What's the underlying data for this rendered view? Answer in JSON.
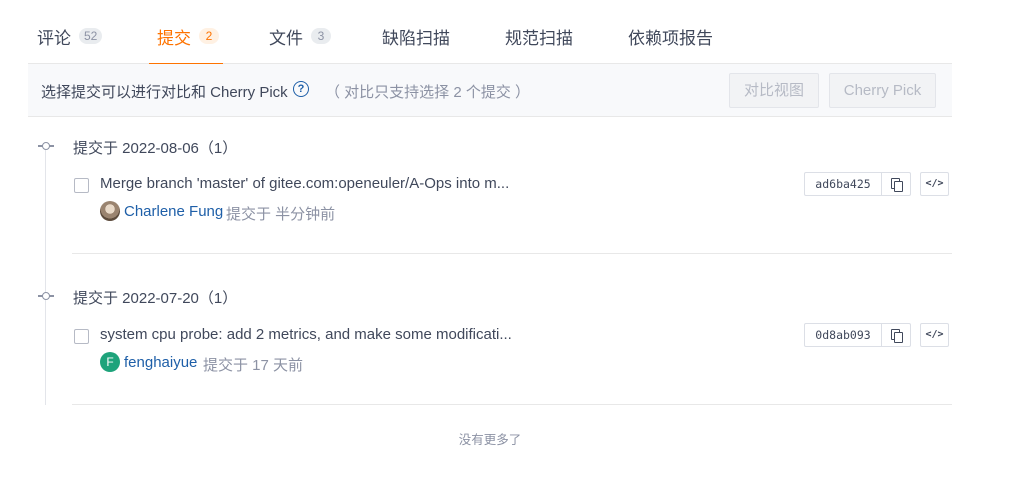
{
  "tabs": [
    {
      "label": "评论",
      "count": "52",
      "active": false
    },
    {
      "label": "提交",
      "count": "2",
      "active": true
    },
    {
      "label": "文件",
      "count": "3",
      "active": false
    },
    {
      "label": "缺陷扫描",
      "count": "",
      "active": false
    },
    {
      "label": "规范扫描",
      "count": "",
      "active": false
    },
    {
      "label": "依赖项报告",
      "count": "",
      "active": false
    }
  ],
  "toolbar": {
    "hint": "选择提交可以进行对比和 Cherry Pick",
    "note": "（ 对比只支持选择 2 个提交 ）",
    "compare_label": "对比视图",
    "cherry_pick_label": "Cherry Pick"
  },
  "groups": [
    {
      "title": "提交于 2022-08-06（1）",
      "commits": [
        {
          "title": "Merge branch 'master' of gitee.com:openeuler/A-Ops into m...",
          "author": "Charlene Fung",
          "meta": "提交于 半分钟前",
          "sha": "ad6ba425",
          "avatar_letter": ""
        }
      ]
    },
    {
      "title": "提交于 2022-07-20（1）",
      "commits": [
        {
          "title": "system cpu probe: add 2 metrics, and make some modificati...",
          "author": "fenghaiyue",
          "meta": "提交于 17 天前",
          "sha": "0d8ab093",
          "avatar_letter": "F"
        }
      ]
    }
  ],
  "footer": {
    "no_more": "没有更多了"
  },
  "colors": {
    "accent": "#fe7300",
    "link": "#1e5fa8",
    "avatar_green": "#1ea37b"
  },
  "icons": {
    "help": "help-circle-icon",
    "copy": "copy-icon",
    "code": "code-icon",
    "timeline": "commit-node-icon"
  }
}
